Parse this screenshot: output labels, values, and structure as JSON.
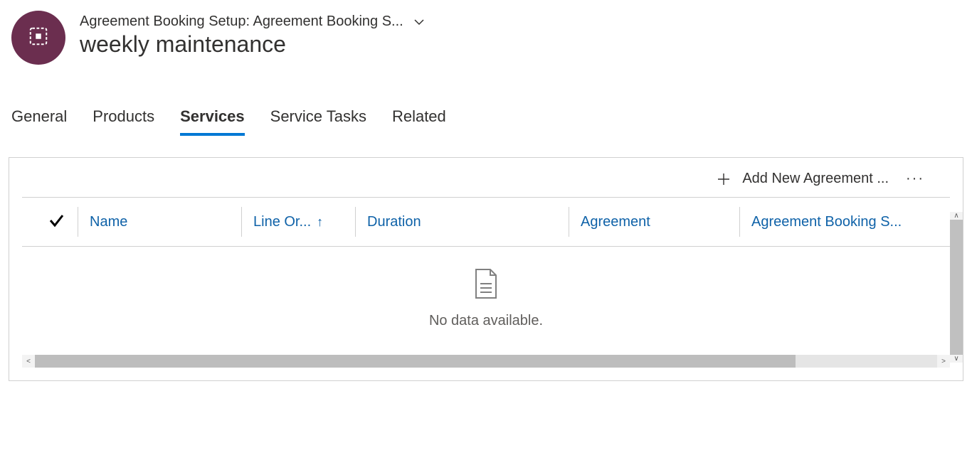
{
  "header": {
    "breadcrumb": "Agreement Booking Setup: Agreement Booking S...",
    "title": "weekly maintenance"
  },
  "tabs": {
    "general": "General",
    "products": "Products",
    "services": "Services",
    "service_tasks": "Service Tasks",
    "related": "Related",
    "active": "services"
  },
  "grid": {
    "add_label": "Add New Agreement ...",
    "columns": {
      "name": "Name",
      "line_order": "Line Or...",
      "duration": "Duration",
      "agreement": "Agreement",
      "agreement_booking_setup": "Agreement Booking S..."
    },
    "sort": {
      "column": "line_order",
      "direction": "asc"
    },
    "empty_message": "No data available.",
    "rows": []
  },
  "icons": {
    "entity": "booking-setup-icon",
    "chevron": "chevron-down-icon",
    "plus": "plus-icon",
    "more": "more-icon",
    "check": "checkmark-icon",
    "sort_asc": "arrow-up-icon",
    "file": "file-icon"
  },
  "colors": {
    "accent": "#0078d4",
    "link": "#0f62a8",
    "badge": "#6b2e4f"
  }
}
